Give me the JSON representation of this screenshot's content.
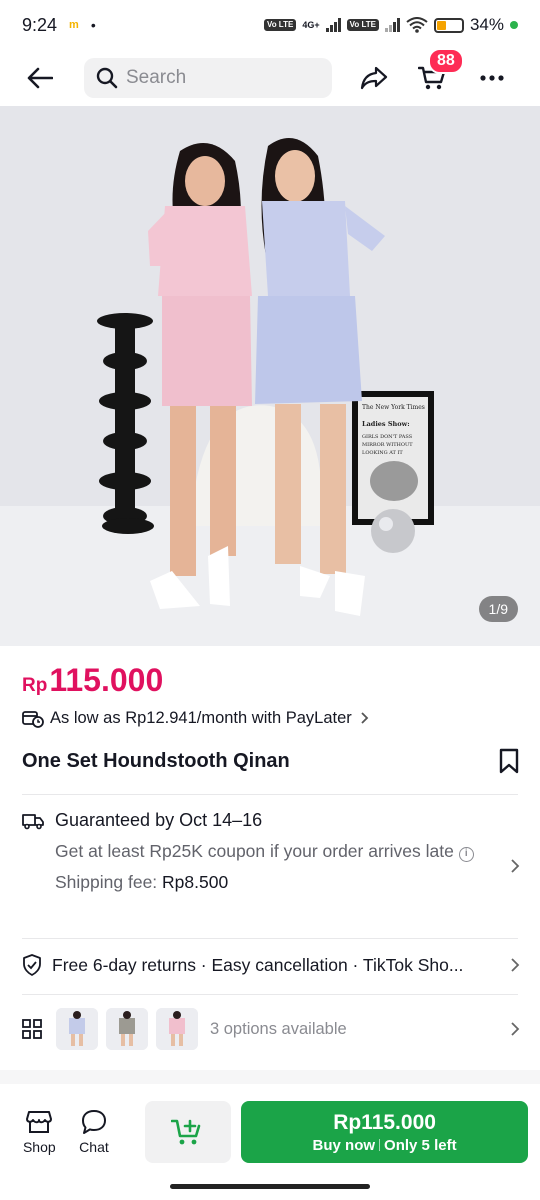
{
  "status_bar": {
    "time": "9:24",
    "notif_m": "m",
    "dot": "•",
    "net_label": "4G+",
    "volte": "Vo LTE",
    "battery": "34%"
  },
  "nav": {
    "search_placeholder": "Search",
    "cart_count": "88"
  },
  "gallery": {
    "counter": "1/9",
    "poster_text": "The New York Times\nLadies Show:\nGIRLS DON'T PASS\nMIRROR WITHOUT\nLOOKING AT IT"
  },
  "product": {
    "currency": "Rp",
    "price": "115.000",
    "paylater": "As low as Rp12.941/month with PayLater",
    "title": "One Set Houndstooth Qinan"
  },
  "shipping": {
    "guarantee": "Guaranteed by Oct 14–16",
    "coupon": "Get at least Rp25K coupon if your order arrives late",
    "fee_label": "Shipping fee:",
    "fee_value": "Rp8.500"
  },
  "returns": {
    "text": "Free 6-day returns · Easy cancellation · TikTok Sho..."
  },
  "options": {
    "text": "3 options available",
    "thumbnails": [
      "option-blue",
      "option-grey",
      "option-pink"
    ]
  },
  "bottom": {
    "shop_label": "Shop",
    "chat_label": "Chat",
    "buy_price": "Rp115.000",
    "buy_label": "Buy now",
    "stock": "Only 5 left"
  },
  "colors": {
    "price": "#e0115f",
    "buy": "#1ba448",
    "badge": "#fe2c55"
  }
}
